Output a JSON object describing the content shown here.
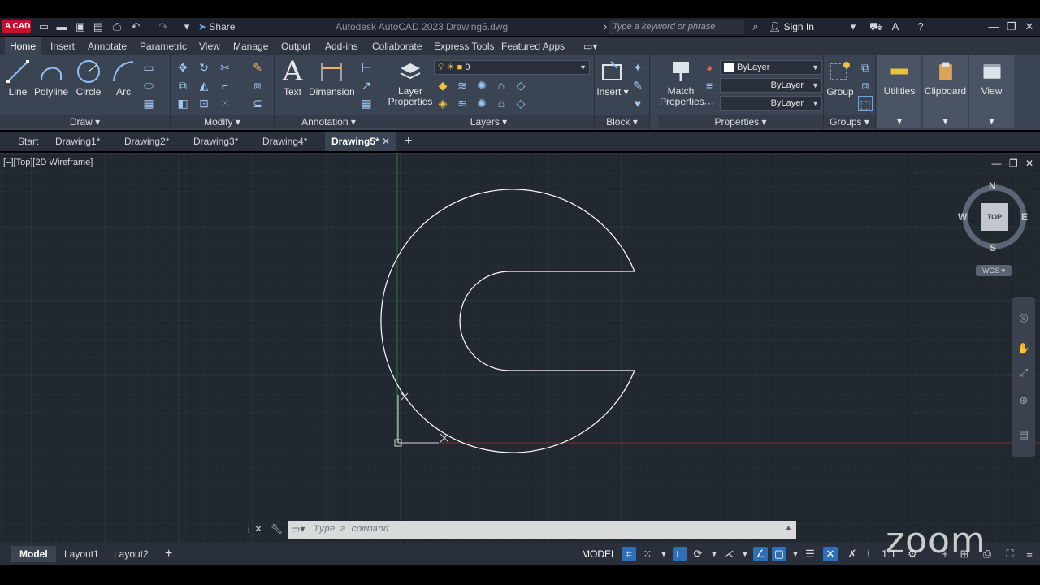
{
  "title_bar": {
    "app_badge": "A CAD",
    "share": "Share",
    "title": "Autodesk AutoCAD 2023    Drawing5.dwg",
    "search_placeholder": "Type a keyword or phrase",
    "sign_in": "Sign In"
  },
  "ribbon_tabs": [
    "Home",
    "Insert",
    "Annotate",
    "Parametric",
    "View",
    "Manage",
    "Output",
    "Add-ins",
    "Collaborate",
    "Express Tools",
    "Featured Apps"
  ],
  "ribbon": {
    "draw": {
      "title": "Draw",
      "tools": [
        "Line",
        "Polyline",
        "Circle",
        "Arc"
      ]
    },
    "modify": {
      "title": "Modify"
    },
    "annotation": {
      "title": "Annotation",
      "tools": [
        "Text",
        "Dimension"
      ]
    },
    "layers": {
      "title": "Layers",
      "layer_properties": "Layer\nProperties",
      "layer_line1": "Layer",
      "layer_line2": "Properties",
      "current_layer": "0"
    },
    "block": {
      "title": "Block",
      "insert": "Insert"
    },
    "properties": {
      "title": "Properties",
      "match_line1": "Match",
      "match_line2": "Properties",
      "color": "ByLayer",
      "linetype": "ByLayer",
      "lineweight": "ByLayer"
    },
    "groups": {
      "title": "Groups",
      "group": "Group"
    },
    "utilities": "Utilities",
    "clipboard": "Clipboard",
    "view": "View"
  },
  "file_tabs": [
    "Start",
    "Drawing1*",
    "Drawing2*",
    "Drawing3*",
    "Drawing4*",
    "Drawing5*"
  ],
  "viewport": {
    "label": "[−][Top][2D Wireframe]",
    "viewcube": {
      "n": "N",
      "s": "S",
      "e": "E",
      "w": "W",
      "face": "TOP"
    },
    "wcs": "WCS"
  },
  "command": {
    "placeholder": "Type a command"
  },
  "layout_tabs": [
    "Model",
    "Layout1",
    "Layout2"
  ],
  "status": {
    "model": "MODEL",
    "scale": "1:1"
  },
  "watermark": "zoom",
  "colors": {
    "accent": "#2f6fb7",
    "canvas": "#212830",
    "ribbon": "#3b4453"
  }
}
